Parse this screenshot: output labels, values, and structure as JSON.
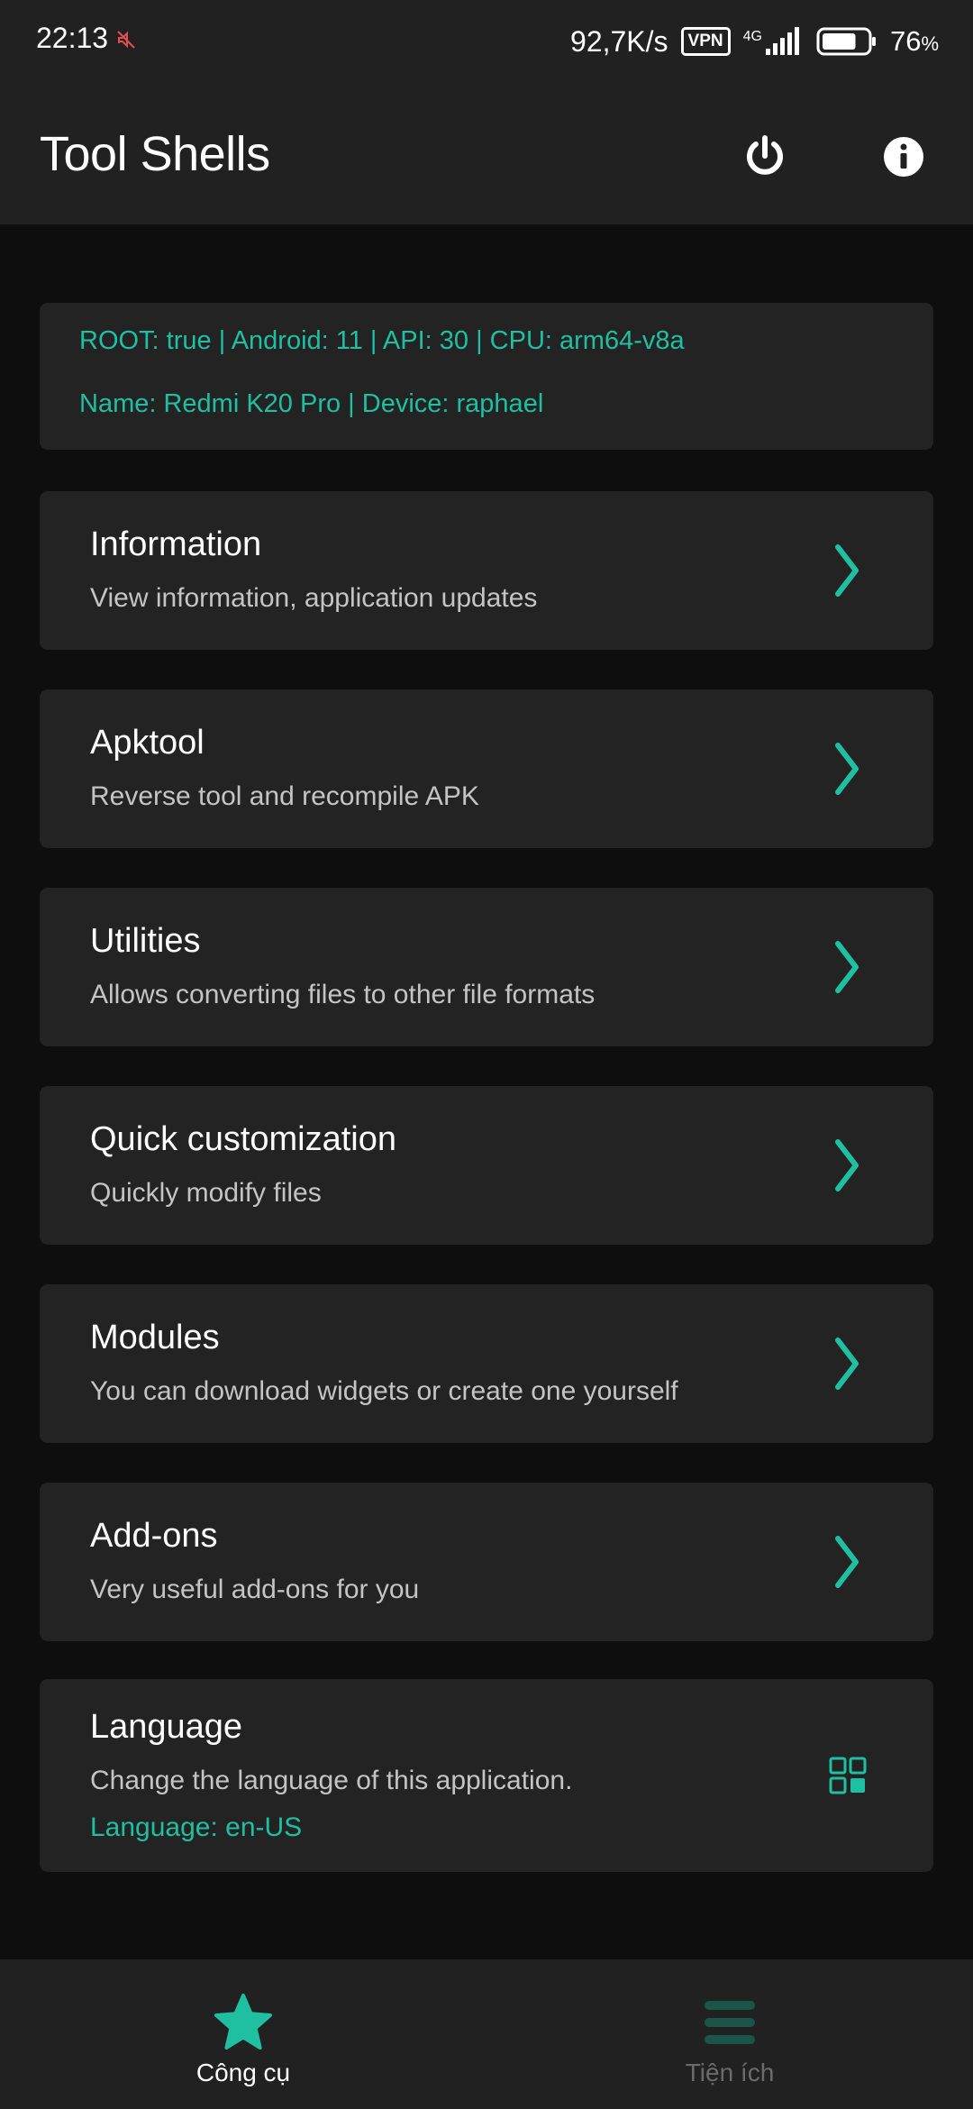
{
  "status_bar": {
    "time": "22:13",
    "net_speed": "92,7K/s",
    "vpn_label": "VPN",
    "network_type": "4G",
    "battery_percent": "76",
    "battery_unit": "%",
    "battery_level": 0.76,
    "icons": [
      "do-not-disturb-icon",
      "signal-icon",
      "battery-icon"
    ]
  },
  "app_bar": {
    "title": "Tool Shells",
    "actions": [
      "power-icon",
      "info-icon"
    ]
  },
  "device_info": {
    "line1": "ROOT: true  |  Android: 11  |  API: 30  |  CPU: arm64-v8a",
    "line2": "Name: Redmi K20 Pro  |  Device: raphael"
  },
  "menu": [
    {
      "title": "Information",
      "subtitle": "View information, application updates"
    },
    {
      "title": "Apktool",
      "subtitle": "Reverse tool and recompile APK"
    },
    {
      "title": "Utilities",
      "subtitle": "Allows converting files to other file formats"
    },
    {
      "title": "Quick customization",
      "subtitle": "Quickly modify files"
    },
    {
      "title": "Modules",
      "subtitle": "You can download widgets or create one yourself"
    },
    {
      "title": "Add-ons",
      "subtitle": "Very useful add-ons for you"
    }
  ],
  "language": {
    "title": "Language",
    "subtitle": "Change the language of this application.",
    "current": "Language: en-US"
  },
  "bottom_nav": [
    {
      "label": "Công cụ",
      "icon": "star-icon",
      "active": true
    },
    {
      "label": "Tiện ích",
      "icon": "menu-icon",
      "active": false
    }
  ],
  "colors": {
    "accent": "#1fbfa1",
    "background": "#0e0e0e",
    "surface": "#232323",
    "bar": "#212121"
  }
}
